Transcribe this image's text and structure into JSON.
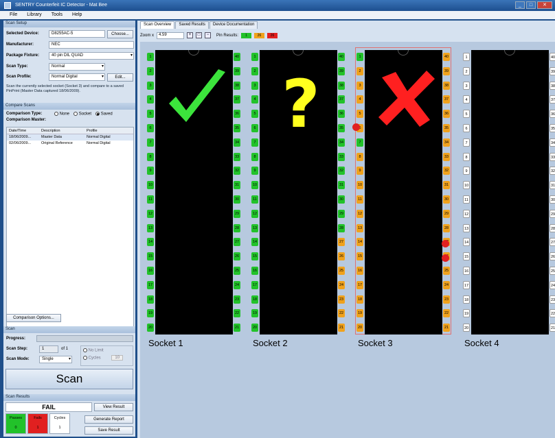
{
  "window": {
    "title": "SENTRY Counterfeit IC Detector - Mat Bee"
  },
  "menu": [
    "File",
    "Library",
    "Tools",
    "Help"
  ],
  "scan_setup": {
    "header": "Scan Setup",
    "selected_device_label": "Selected Device:",
    "selected_device": "D8255AC-5",
    "choose_label": "Choose...",
    "manufacturer_label": "Manufacturer:",
    "manufacturer": "NEC",
    "package_label": "Package Fixture:",
    "package": "40 pin DIL QUAD",
    "scan_type_label": "Scan Type:",
    "scan_type": "Normal",
    "scan_profile_label": "Scan Profile:",
    "scan_profile": "Normal Digital",
    "edit_label": "Edit...",
    "note": "Scan the currently selected socket (Socket 3) and compare to a saved PinPrint (Master Data captured 18/06/2009)."
  },
  "compare": {
    "header": "Compare Scans",
    "type_label": "Comparison Type:",
    "opt_none": "None",
    "opt_socket": "Socket",
    "opt_saved": "Saved",
    "master_label": "Comparison Master:",
    "columns": [
      "Date/Time",
      "Description",
      "Profile"
    ],
    "rows": [
      [
        "18/06/2009...",
        "Master Data",
        "Normal Digital"
      ],
      [
        "02/06/2009...",
        "Original Reference",
        "Normal Digital"
      ]
    ],
    "options_label": "Comparison Options..."
  },
  "scan": {
    "header": "Scan",
    "progress_label": "Progress:",
    "step_label": "Scan Step:",
    "step_value": "1",
    "step_of": "of 1",
    "mode_label": "Scan Mode:",
    "mode_value": "Single",
    "no_limit": "No Limit",
    "cycles": "Cycles",
    "cycles_value": "10",
    "scan_button": "Scan"
  },
  "results": {
    "header": "Scan Results",
    "status": "FAIL",
    "view_label": "View Result",
    "report_label": "Generate Report",
    "save_label": "Save Result",
    "passes_label": "Passes",
    "passes": "0",
    "fails_label": "Fails",
    "fails": "1",
    "cycles_label": "Cycles",
    "cycles": "1"
  },
  "tabs": [
    "Scan Overview",
    "Saved Results",
    "Device Documentation"
  ],
  "toolbar": {
    "zoom_label": "Zoom x",
    "zoom": "4.59",
    "pin_results_label": "Pin Results:",
    "legend": [
      "1",
      "26",
      "26"
    ]
  },
  "colors": {
    "pass": "#22c22a",
    "warn": "#f0a21c",
    "fail": "#e12020",
    "check": "#3ce43c",
    "question": "#ffff1e",
    "cross": "#ff2020"
  },
  "sockets": [
    {
      "label": "Socket 1",
      "result": "pass",
      "symbol": "check-icon"
    },
    {
      "label": "Socket 2",
      "result": "unknown",
      "symbol": "question-icon",
      "symbol_text": "?"
    },
    {
      "label": "Socket 3",
      "result": "fail",
      "symbol": "cross-icon"
    },
    {
      "label": "Socket 4",
      "result": "empty",
      "symbol": ""
    }
  ],
  "pin_labels": {
    "left": [
      "1",
      "2",
      "3",
      "4",
      "5",
      "6",
      "7",
      "8",
      "9",
      "10",
      "11",
      "12",
      "13",
      "14",
      "15",
      "16",
      "17",
      "18",
      "19",
      "20"
    ],
    "right": [
      "40",
      "39",
      "38",
      "37",
      "36",
      "35",
      "34",
      "33",
      "32",
      "31",
      "30",
      "29",
      "28",
      "27",
      "26",
      "25",
      "24",
      "23",
      "22",
      "21"
    ]
  }
}
